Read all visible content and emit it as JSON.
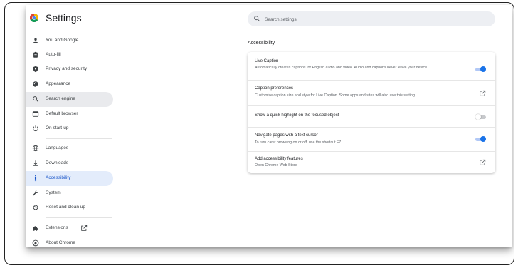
{
  "header": {
    "title": "Settings",
    "search_placeholder": "Search settings"
  },
  "sidebar": {
    "items": [
      {
        "label": "You and Google",
        "icon": "person-icon"
      },
      {
        "label": "Auto-fill",
        "icon": "clipboard-icon"
      },
      {
        "label": "Privacy and security",
        "icon": "shield-icon"
      },
      {
        "label": "Appearance",
        "icon": "palette-icon"
      },
      {
        "label": "Search engine",
        "icon": "search-icon",
        "state": "hover"
      },
      {
        "label": "Default browser",
        "icon": "browser-icon"
      },
      {
        "label": "On start-up",
        "icon": "power-icon"
      },
      {
        "label": "Languages",
        "icon": "globe-icon"
      },
      {
        "label": "Downloads",
        "icon": "download-icon"
      },
      {
        "label": "Accessibility",
        "icon": "accessibility-icon",
        "state": "active"
      },
      {
        "label": "System",
        "icon": "wrench-icon"
      },
      {
        "label": "Reset and clean up",
        "icon": "reset-icon"
      },
      {
        "label": "Extensions",
        "icon": "puzzle-icon"
      },
      {
        "label": "About Chrome",
        "icon": "chrome-icon"
      }
    ]
  },
  "main": {
    "section_title": "Accessibility",
    "rows": [
      {
        "title": "Live Caption",
        "subtitle": "Automatically creates captions for English audio and video. Audio and captions never leave your device.",
        "control": "toggle",
        "enabled": true
      },
      {
        "title": "Caption preferences",
        "subtitle": "Customise caption size and style for Live Caption. Some apps and sites will also use this setting.",
        "control": "open-in-new"
      },
      {
        "title": "Show a quick highlight on the focused object",
        "subtitle": "",
        "control": "toggle",
        "enabled": false
      },
      {
        "title": "Navigate pages with a text cursor",
        "subtitle": "To turn caret browsing on or off, use the shortcut F7",
        "control": "toggle",
        "enabled": true
      },
      {
        "title": "Add accessibility features",
        "subtitle": "Open Chrome Web Store",
        "control": "open-in-new"
      }
    ]
  },
  "colors": {
    "accent": "#1a73e8",
    "active_bg": "#e3ecfb",
    "hover_bg": "#e9eaed",
    "search_bg": "#edeff3"
  }
}
